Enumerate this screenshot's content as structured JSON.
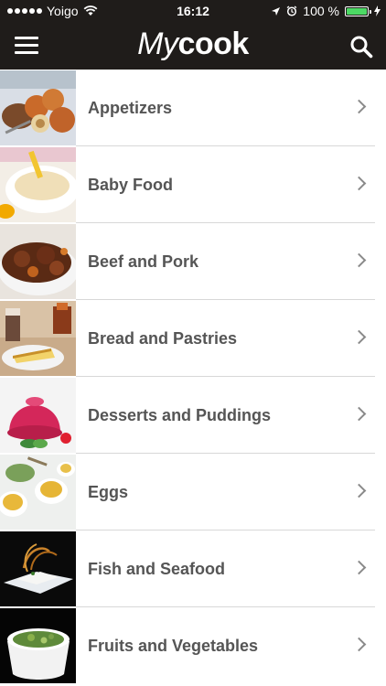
{
  "status": {
    "carrier": "Yoigo",
    "time": "16:12",
    "battery": "100 %"
  },
  "header": {
    "logo_my": "My",
    "logo_cook": "cook",
    "menu_icon": "hamburger-menu-icon",
    "search_icon": "search-icon"
  },
  "categories": [
    {
      "label": "Appetizers"
    },
    {
      "label": "Baby Food"
    },
    {
      "label": "Beef and Pork"
    },
    {
      "label": "Bread and Pastries"
    },
    {
      "label": "Desserts and Puddings"
    },
    {
      "label": "Eggs"
    },
    {
      "label": "Fish and Seafood"
    },
    {
      "label": "Fruits and Vegetables"
    }
  ],
  "colors": {
    "header_bg": "#1f1c1a",
    "text": "#555555",
    "battery": "#4cd964"
  }
}
